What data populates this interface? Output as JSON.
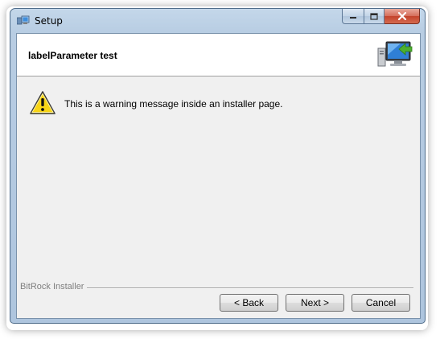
{
  "window": {
    "title": "Setup"
  },
  "header": {
    "title": "labelParameter test",
    "image_icon": "computer-install-icon"
  },
  "content": {
    "warning_icon": "warning-icon",
    "warning_message": "This is a warning message inside an installer page."
  },
  "footer": {
    "branding": "BitRock Installer",
    "back_label": "< Back",
    "next_label": "Next >",
    "cancel_label": "Cancel"
  },
  "caption_buttons": {
    "minimize": "minimize-icon",
    "maximize": "maximize-icon",
    "close": "close-icon"
  },
  "colors": {
    "frame": "#b8cde3",
    "client_bg": "#f0f0f0",
    "header_bg": "#ffffff",
    "close_button": "#c4432c",
    "warning_yellow": "#f7d417"
  }
}
